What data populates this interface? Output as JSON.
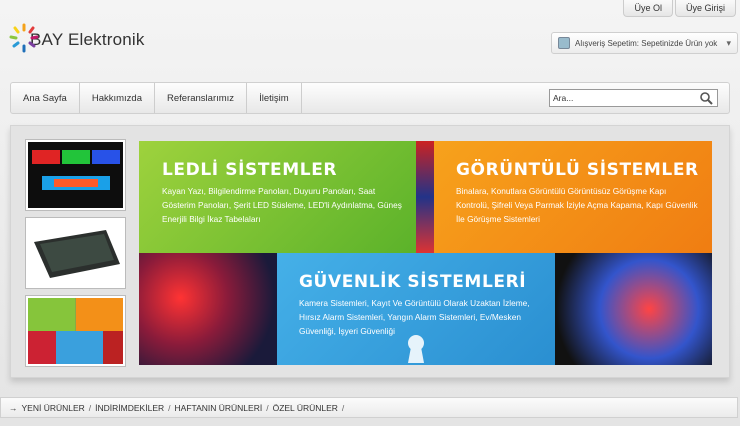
{
  "toplinks": {
    "register": "Üye Ol",
    "login": "Üye Girişi"
  },
  "logo": {
    "text": "BAY Elektronik"
  },
  "cart": {
    "text": "Alışveriş Sepetim: Sepetinizde Ürün yok"
  },
  "nav": {
    "items": [
      "Ana Sayfa",
      "Hakkımızda",
      "Referanslarımız",
      "İletişim"
    ]
  },
  "search": {
    "value": "Ara..."
  },
  "banner": {
    "led": {
      "title": "LEDLİ SİSTEMLER",
      "text": "Kayan Yazı, Bilgilendirme Panoları, Duyuru Panoları, Saat Gösterim Panoları, Şerit LED Süsleme, LED'li Aydınlatma, Güneş Enerjili Bilgi İkaz Tabelaları"
    },
    "video": {
      "title": "GÖRÜNTÜLÜ SİSTEMLER",
      "text": "Binalara, Konutlara Görüntülü Görüntüsüz Görüşme Kapı Kontrolü, Şifreli Veya Parmak İziyle Açma Kapama, Kapı Güvenlik İle Görüşme Sistemleri"
    },
    "security": {
      "title": "GÜVENLİK SİSTEMLERİ",
      "text": "Kamera Sistemleri, Kayıt Ve Görüntülü Olarak Uzaktan İzleme, Hırsız Alarm Sistemleri, Yangın Alarm Sistemleri, Ev/Mesken Güvenliği, İşyeri Güvenliği"
    }
  },
  "tabs": {
    "items": [
      "YENİ ÜRÜNLER",
      "İNDİRİMDEKİLER",
      "HAFTANIN ÜRÜNLERİ",
      "ÖZEL ÜRÜNLER"
    ]
  },
  "colors": {
    "green": "#7cc22f",
    "orange": "#f39018",
    "blue": "#3aa0dd"
  }
}
